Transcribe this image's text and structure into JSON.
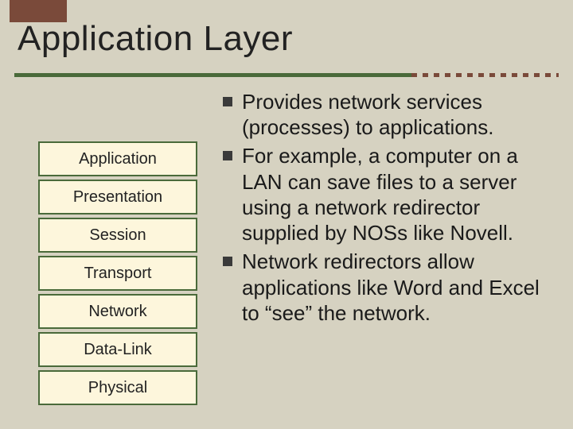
{
  "title": "Application Layer",
  "layers": {
    "0": "Application",
    "1": "Presentation",
    "2": "Session",
    "3": "Transport",
    "4": "Network",
    "5": "Data-Link",
    "6": "Physical"
  },
  "bullets": {
    "0": "Provides network services (processes) to applications.",
    "1": "For example, a computer on a LAN can save files to a server using a network redirector supplied by NOSs like Novell.",
    "2": "Network redirectors allow applications like Word and Excel to “see” the network."
  },
  "colors": {
    "background": "#d6d2c1",
    "accent_brown": "#7a4a3a",
    "accent_green": "#4a6a3a",
    "box_fill": "#fdf6dc"
  }
}
